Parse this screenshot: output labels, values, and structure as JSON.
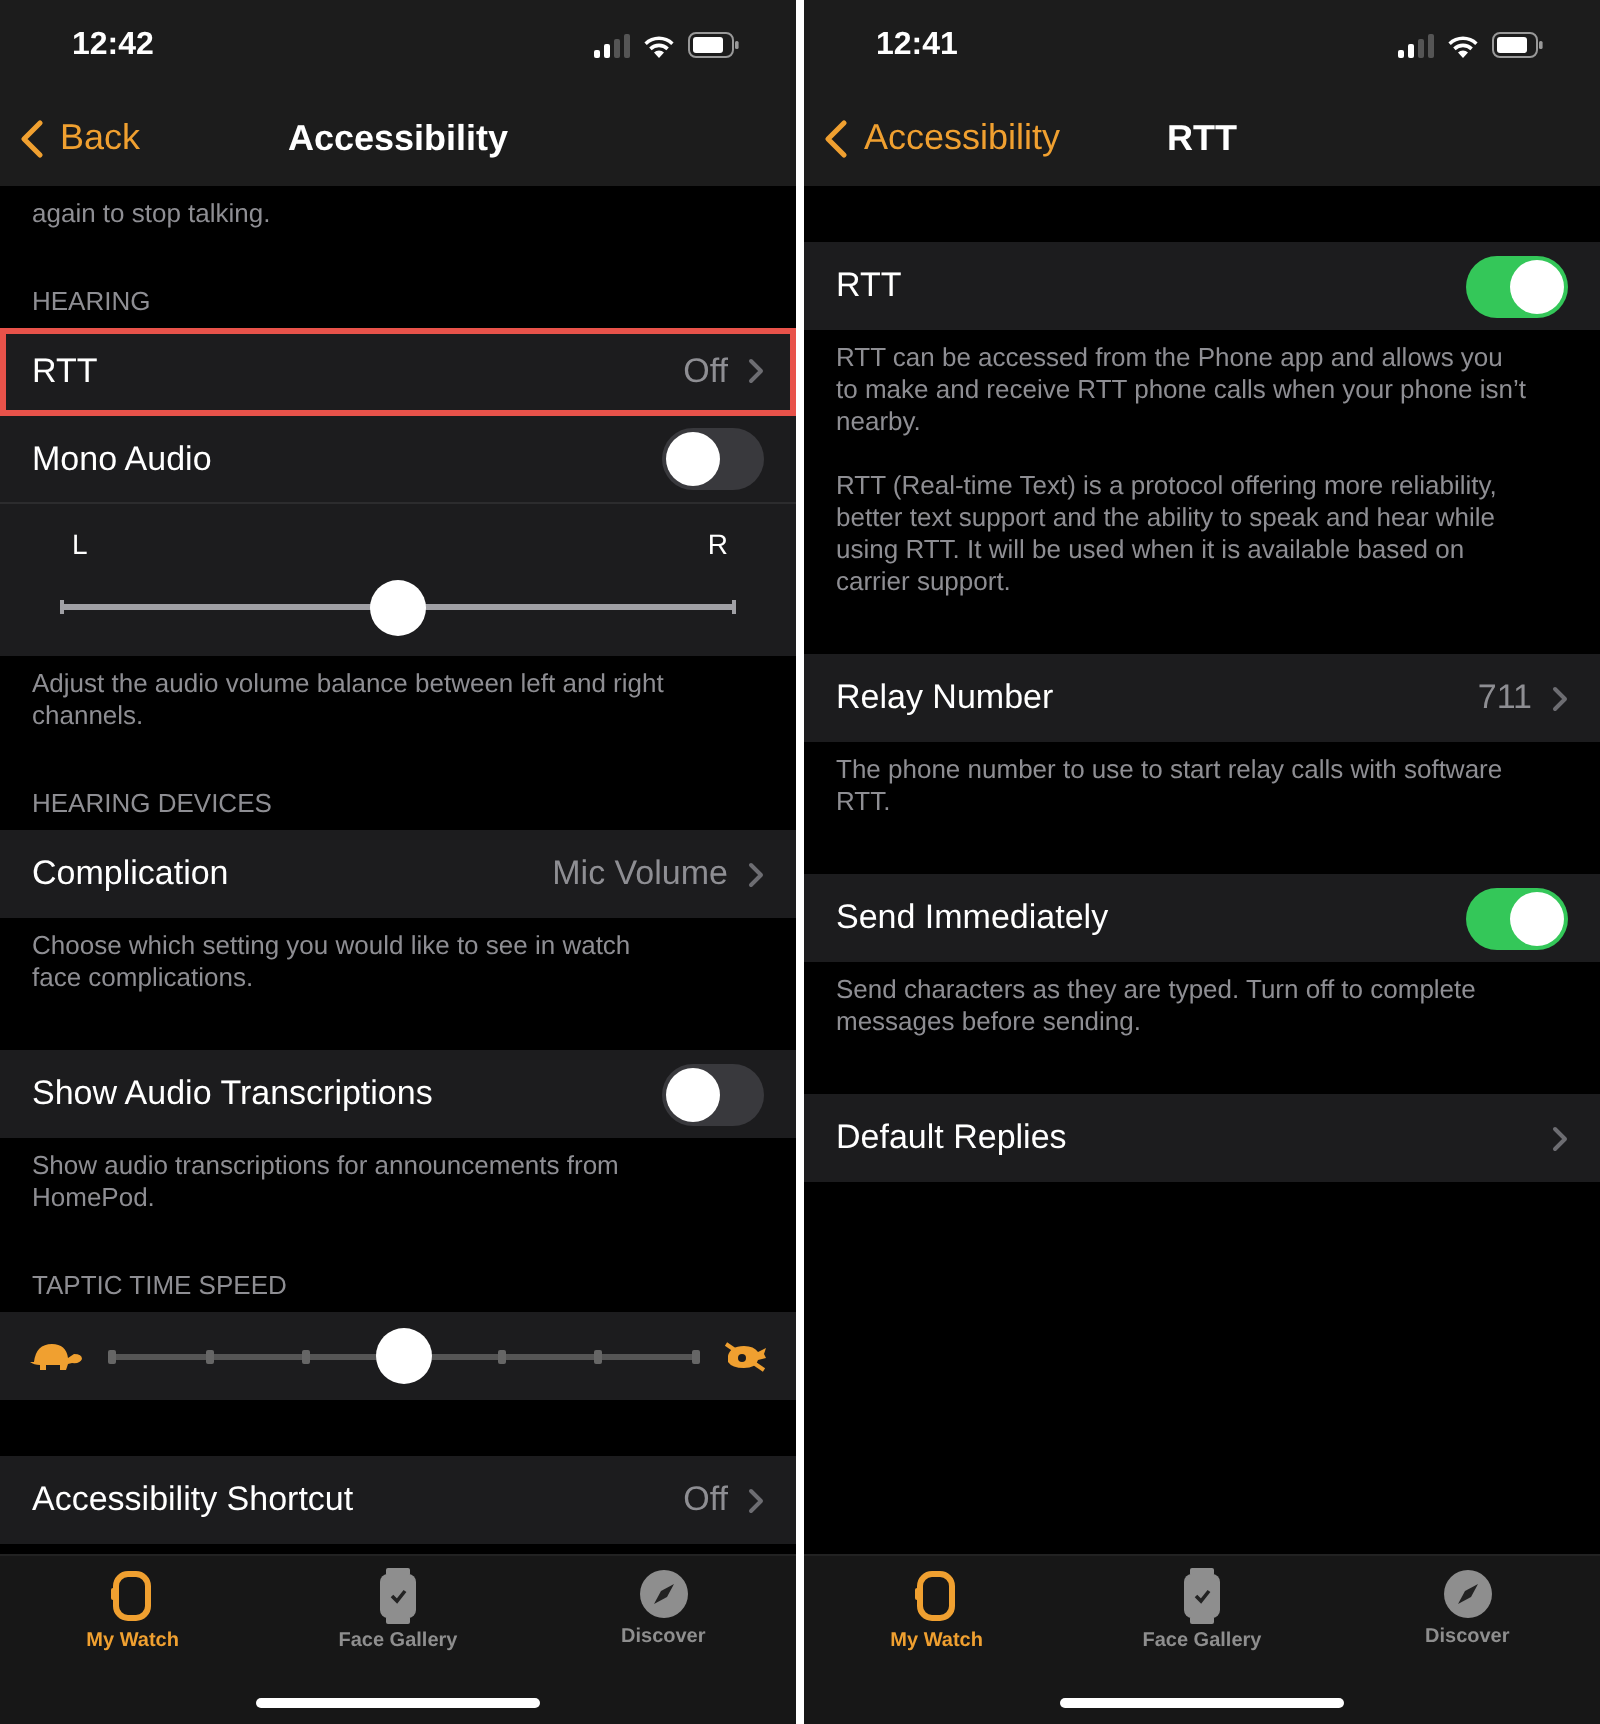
{
  "panels": [
    {
      "status_bar": {
        "time": "12:42"
      },
      "nav": {
        "back": "Back",
        "title": "Accessibility"
      },
      "sections": [
        {
          "notes": [
            "again to stop talking."
          ]
        },
        {
          "header": "HEARING",
          "rows": [
            {
              "kind": "nav",
              "label": "RTT",
              "value": "Off",
              "highlighted": true
            },
            {
              "kind": "toggle",
              "label": "Mono Audio",
              "on": false
            },
            {
              "kind": "balance",
              "left": "L",
              "right": "R",
              "level": 0.5
            }
          ],
          "notes": [
            "Adjust the audio volume balance between left and right channels."
          ]
        },
        {
          "header": "HEARING DEVICES",
          "rows": [
            {
              "kind": "nav",
              "label": "Complication",
              "value": "Mic Volume",
              "highlighted": false
            }
          ],
          "notes": [
            "Choose which setting you would like to see in watch face complications."
          ]
        },
        {
          "rows": [
            {
              "kind": "toggle",
              "label": "Show Audio Transcriptions",
              "on": false
            }
          ],
          "notes": [
            "Show audio transcriptions for announcements from HomePod."
          ]
        },
        {
          "header": "TAPTIC TIME SPEED",
          "rows": [
            {
              "kind": "speed",
              "level": 0.5
            }
          ]
        },
        {
          "rows": [
            {
              "kind": "nav",
              "label": "Accessibility Shortcut",
              "value": "Off",
              "highlighted": false
            }
          ]
        }
      ],
      "tabs": [
        {
          "label": "My Watch",
          "selected": true
        },
        {
          "label": "Face Gallery",
          "selected": false
        },
        {
          "label": "Discover",
          "selected": false
        }
      ]
    },
    {
      "status_bar": {
        "time": "12:41"
      },
      "nav": {
        "back": "Accessibility",
        "title": "RTT"
      },
      "sections": [
        {
          "rows": [
            {
              "kind": "toggle",
              "label": "RTT",
              "on": true
            }
          ],
          "notes": [
            "RTT can be accessed from the Phone app and allows you to make and receive RTT phone calls when your phone isn’t nearby.",
            "RTT (Real-time Text) is a protocol offering more reliability, better text support and the ability to speak and hear while using RTT. It will be used when it is available based on carrier support."
          ]
        },
        {
          "rows": [
            {
              "kind": "nav",
              "label": "Relay Number",
              "value": "711",
              "highlighted": false
            }
          ],
          "notes": [
            "The phone number to use to start relay calls with software RTT."
          ]
        },
        {
          "rows": [
            {
              "kind": "toggle",
              "label": "Send Immediately",
              "on": true
            }
          ],
          "notes": [
            "Send characters as they are typed. Turn off to complete messages before sending."
          ]
        },
        {
          "rows": [
            {
              "kind": "nav",
              "label": "Default Replies",
              "highlighted": false
            }
          ]
        }
      ],
      "tabs": [
        {
          "label": "My Watch",
          "selected": true
        },
        {
          "label": "Face Gallery",
          "selected": false
        },
        {
          "label": "Discover",
          "selected": false
        }
      ]
    }
  ]
}
